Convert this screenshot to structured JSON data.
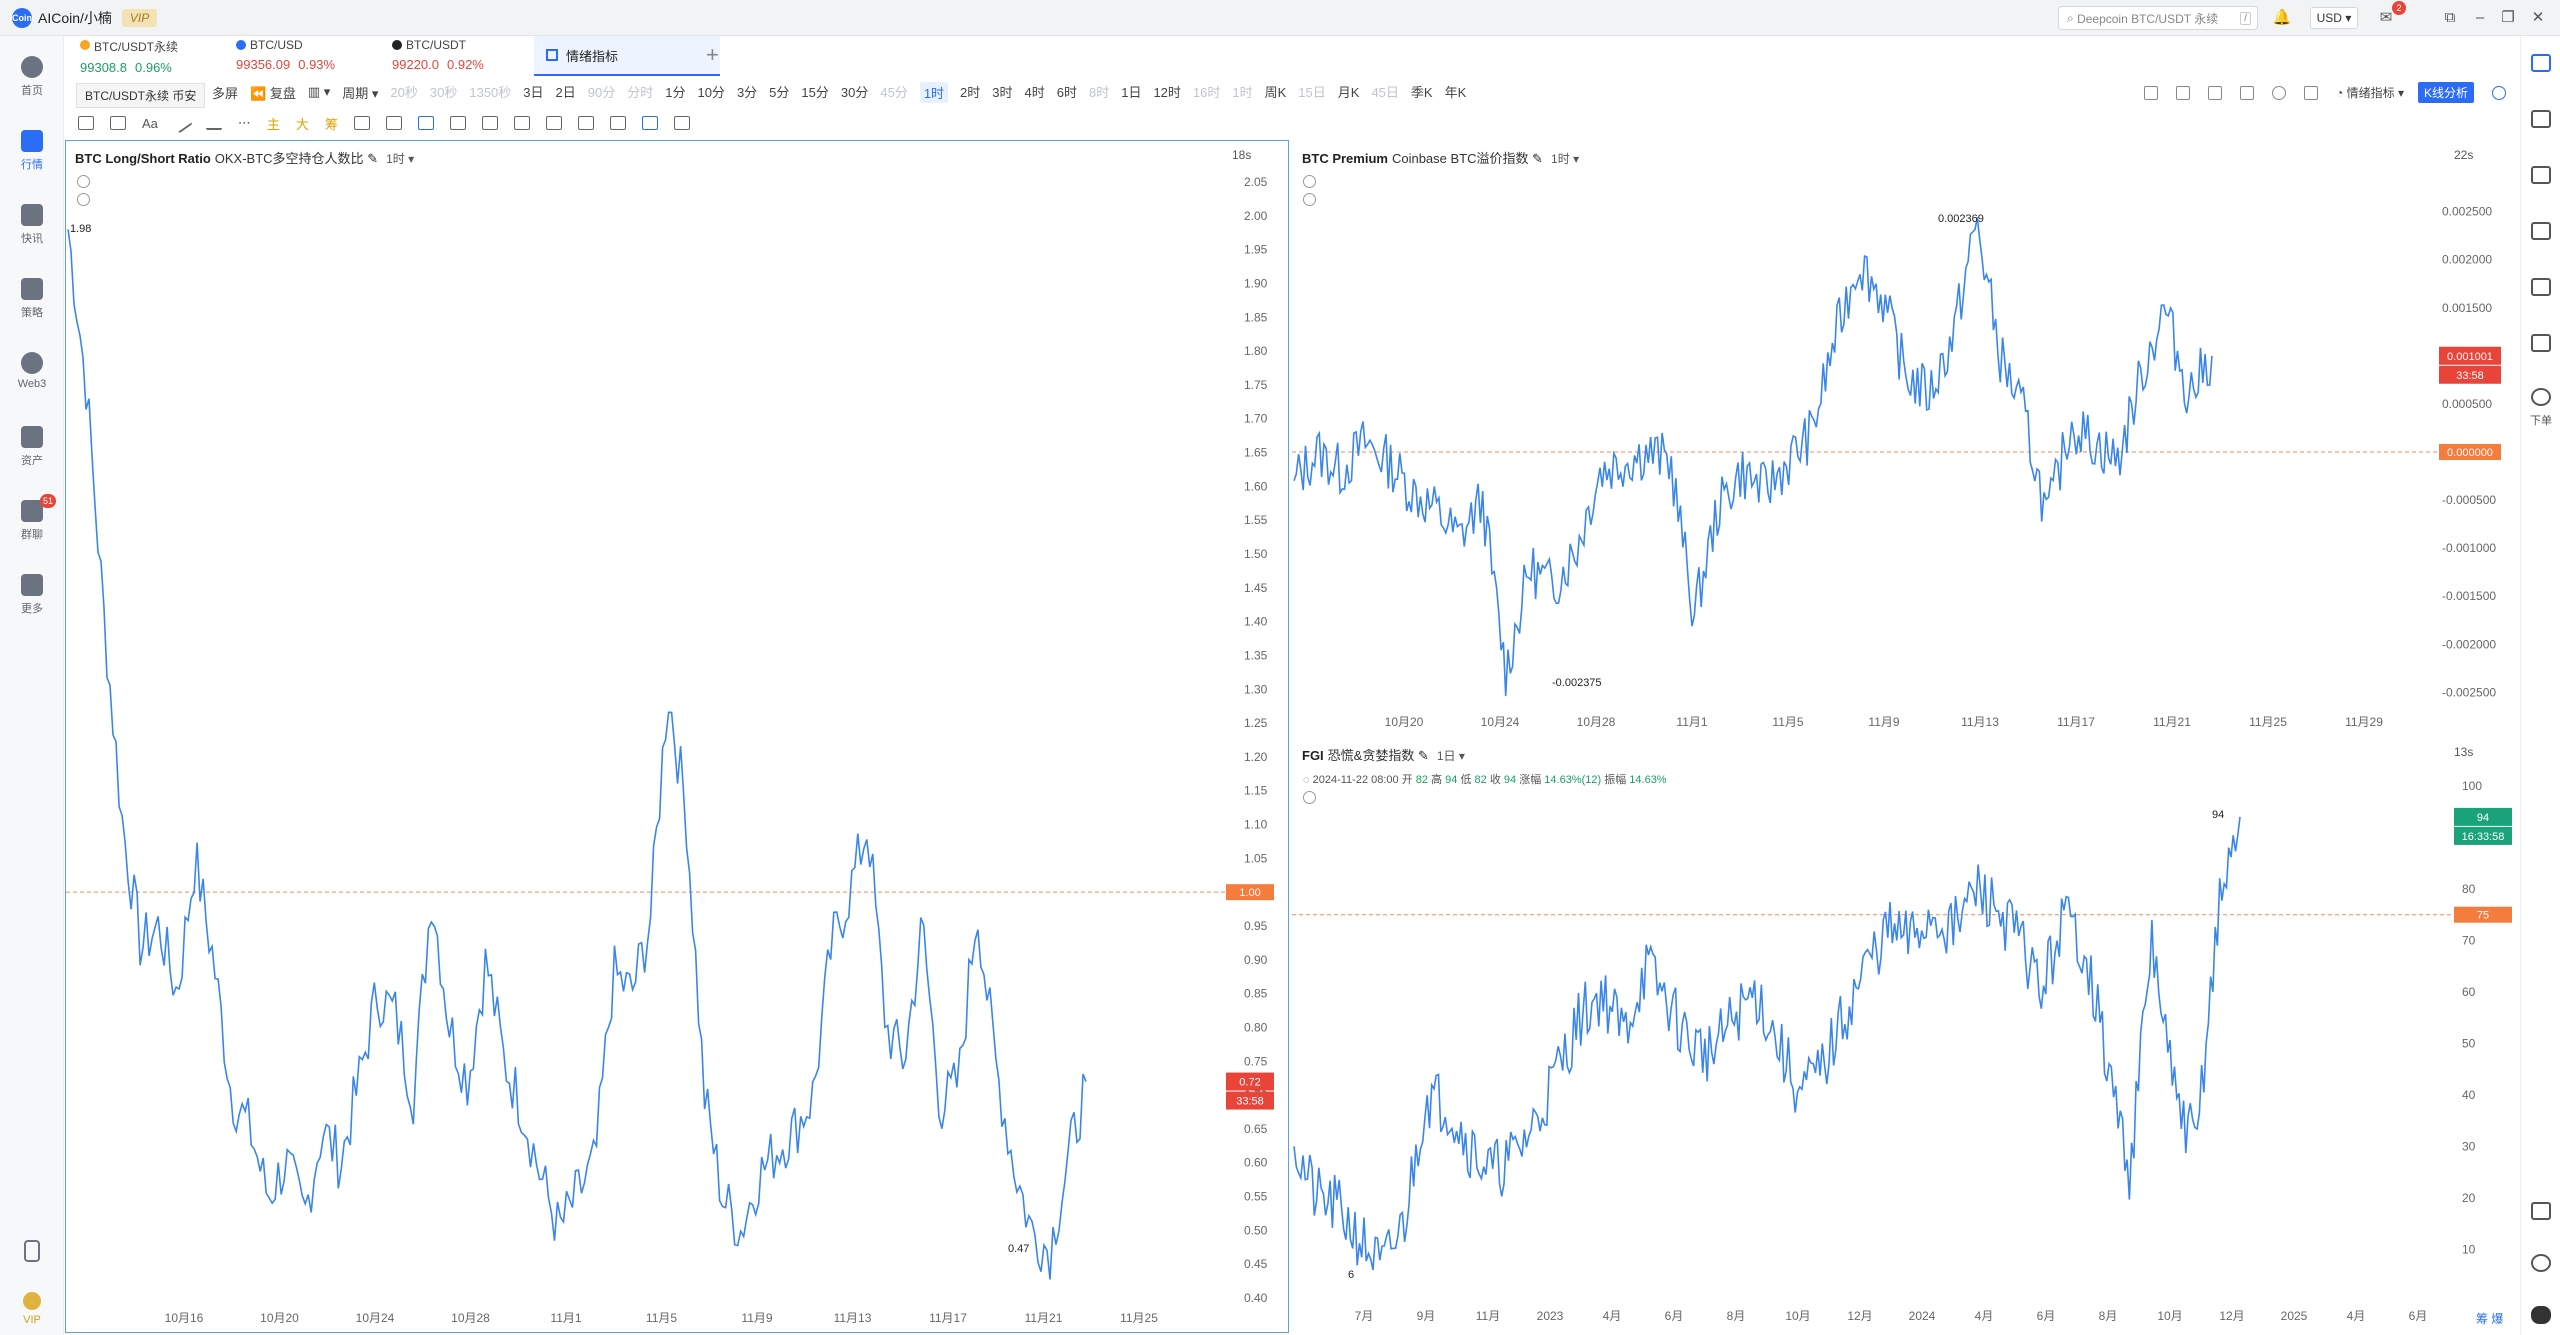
{
  "titlebar": {
    "logo_text": "Coin",
    "app_title": "AICoin/小楠",
    "vip": "VIP",
    "search_placeholder": "Deepcoin BTC/USDT 永续",
    "search_kbd": "/",
    "currency": "USD",
    "notifications": "2"
  },
  "sidebar": [
    {
      "label": "首页",
      "icon": "globe-icon"
    },
    {
      "label": "行情",
      "icon": "chart-icon",
      "active": true
    },
    {
      "label": "快讯",
      "icon": "news-icon"
    },
    {
      "label": "策略",
      "icon": "robot-icon"
    },
    {
      "label": "Web3",
      "icon": "web3-icon"
    },
    {
      "label": "资产",
      "icon": "wallet-icon"
    },
    {
      "label": "群聊",
      "icon": "chat-icon",
      "badge": "51"
    },
    {
      "label": "更多",
      "icon": "grid-icon"
    },
    {
      "label": "",
      "icon": "phone-icon"
    },
    {
      "label": "VIP",
      "icon": "vip-icon"
    }
  ],
  "rightbar": {
    "order_label": "下单"
  },
  "tickers": [
    {
      "name": "BTC/USDT永续",
      "price": "99308.8",
      "change": "0.96%",
      "dir": "up",
      "dot": "#f5a623"
    },
    {
      "name": "BTC/USD",
      "price": "99356.09",
      "change": "0.93%",
      "dir": "down",
      "dot": "#2a6df4"
    },
    {
      "name": "BTC/USDT",
      "price": "99220.0",
      "change": "0.92%",
      "dir": "down",
      "dot": "#222222"
    }
  ],
  "active_tab": "情绪指标",
  "tooltip": "BTC/USDT永续 币安",
  "periodbar": {
    "left": [
      "多屏",
      "复盘",
      "周期"
    ],
    "periods": [
      {
        "t": "20秒",
        "dim": true
      },
      {
        "t": "30秒",
        "dim": true
      },
      {
        "t": "1350秒",
        "dim": true
      },
      {
        "t": "3日"
      },
      {
        "t": "2日"
      },
      {
        "t": "90分",
        "dim": true
      },
      {
        "t": "分时",
        "dim": true
      },
      {
        "t": "1分"
      },
      {
        "t": "10分"
      },
      {
        "t": "3分"
      },
      {
        "t": "5分"
      },
      {
        "t": "15分"
      },
      {
        "t": "30分"
      },
      {
        "t": "45分",
        "dim": true
      },
      {
        "t": "1时",
        "active": true
      },
      {
        "t": "2时"
      },
      {
        "t": "3时"
      },
      {
        "t": "4时"
      },
      {
        "t": "6时"
      },
      {
        "t": "8时",
        "dim": true
      },
      {
        "t": "1日"
      },
      {
        "t": "12时"
      },
      {
        "t": "16时",
        "dim": true
      },
      {
        "t": "1时",
        "dim": true
      },
      {
        "t": "周K"
      },
      {
        "t": "15日",
        "dim": true
      },
      {
        "t": "月K"
      },
      {
        "t": "45日",
        "dim": true
      },
      {
        "t": "季K"
      },
      {
        "t": "年K"
      }
    ],
    "indicator_label": "情绪指标",
    "kline_button": "K线分析"
  },
  "drawbar": {
    "labels": [
      "Aa",
      "主",
      "大",
      "筹"
    ]
  },
  "panels": {
    "ls": {
      "title": "BTC Long/Short Ratio",
      "subtitle": "OKX-BTC多空持仓人数比",
      "timeframe": "1时",
      "timer": "18s",
      "price_tag": "0.72",
      "countdown": "33:58",
      "ref_tag": "1.00",
      "max_label": "1.98",
      "min_label": "0.47"
    },
    "premium": {
      "title": "BTC Premium",
      "subtitle": "Coinbase BTC溢价指数",
      "timeframe": "1时",
      "timer": "22s",
      "price_tag": "0.001001",
      "countdown": "33:58",
      "ref_tag": "0.000000",
      "max_label": "0.002369",
      "min_label": "-0.002375"
    },
    "fgi": {
      "title": "FGI",
      "subtitle": "恐慌&贪婪指数",
      "timeframe": "1日",
      "timer": "13s",
      "ohlc_date": "2024-11-22 08:00",
      "ohlc_open": "82",
      "ohlc_high": "94",
      "ohlc_low": "82",
      "ohlc_close": "94",
      "ohlc_change": "14.63%(12)",
      "ohlc_amp": "14.63%",
      "l_open": "开",
      "l_high": "高",
      "l_low": "低",
      "l_close": "收",
      "l_change": "涨幅",
      "l_amp": "振幅",
      "price_tag": "94",
      "countdown": "16:33:58",
      "ref_tag": "75",
      "max_label": "94",
      "min_label": "6",
      "corner": "筹  爆"
    }
  },
  "chart_data": [
    {
      "type": "line",
      "title": "BTC Long/Short Ratio",
      "ylim": [
        0.4,
        2.05
      ],
      "yticks": [
        "2.05",
        "2.00",
        "1.95",
        "1.90",
        "1.85",
        "1.80",
        "1.75",
        "1.70",
        "1.65",
        "1.60",
        "1.55",
        "1.50",
        "1.45",
        "1.40",
        "1.35",
        "1.30",
        "1.25",
        "1.20",
        "1.15",
        "1.10",
        "1.05",
        "1.00",
        "0.95",
        "0.90",
        "0.85",
        "0.80",
        "0.75",
        "0.70",
        "0.65",
        "0.60",
        "0.55",
        "0.50",
        "0.45",
        "0.40"
      ],
      "xticks": [
        "10月16",
        "10月20",
        "10月24",
        "10月28",
        "11月1",
        "11月5",
        "11月9",
        "11月13",
        "11月17",
        "11月21",
        "11月25"
      ],
      "series": [
        {
          "values": [
            1.98,
            1.75,
            1.4,
            1.1,
            0.92,
            0.95,
            0.85,
            1.05,
            0.9,
            0.7,
            0.65,
            0.55,
            0.6,
            0.52,
            0.65,
            0.6,
            0.72,
            0.85,
            0.82,
            0.7,
            1.0,
            0.8,
            0.72,
            0.9,
            0.75,
            0.68,
            0.58,
            0.5,
            0.55,
            0.6,
            0.88,
            0.85,
            0.95,
            1.3,
            1.12,
            0.7,
            0.55,
            0.5,
            0.58,
            0.62,
            0.65,
            0.7,
            0.92,
            1.0,
            1.1,
            0.8,
            0.75,
            0.95,
            0.68,
            0.72,
            0.98,
            0.75,
            0.6,
            0.5,
            0.47,
            0.6,
            0.72
          ]
        }
      ]
    },
    {
      "type": "line",
      "title": "BTC Premium",
      "ylim": [
        -0.0026,
        0.0026
      ],
      "yticks": [
        "0.002500",
        "0.002000",
        "0.001500",
        "0.001000",
        "0.000500",
        "0.000000",
        "-0.000500",
        "-0.001000",
        "-0.001500",
        "-0.002000",
        "-0.002500"
      ],
      "xticks": [
        "10月20",
        "10月24",
        "10月28",
        "11月1",
        "11月5",
        "11月9",
        "11月13",
        "11月17",
        "11月21",
        "11月25",
        "11月29"
      ],
      "series": [
        {
          "values": [
            -0.0003,
            0.0,
            -0.0002,
            0.0001,
            -0.0001,
            -0.0004,
            -0.0006,
            -0.0009,
            -0.0005,
            -0.0023,
            -0.0012,
            -0.0014,
            -0.001,
            -0.0002,
            -0.0001,
            0.0,
            -0.0001,
            -0.0017,
            -0.0006,
            -0.0002,
            -0.0004,
            -0.0001,
            0.0002,
            0.0012,
            0.002,
            0.0016,
            0.0008,
            0.0006,
            0.0012,
            0.0024,
            0.001,
            0.0004,
            -0.0007,
            0.0003,
            0.0001,
            -0.0001,
            0.0008,
            0.0015,
            0.0006,
            0.001
          ]
        }
      ]
    },
    {
      "type": "line",
      "title": "FGI",
      "ylim": [
        6,
        100
      ],
      "yticks": [
        "100",
        "90",
        "80",
        "70",
        "60",
        "50",
        "40",
        "30",
        "20",
        "10"
      ],
      "xticks": [
        "7月",
        "9月",
        "11月",
        "2023",
        "4月",
        "6月",
        "8月",
        "10月",
        "12月",
        "2024",
        "4月",
        "6月",
        "8月",
        "10月",
        "12月",
        "2025",
        "4月",
        "6月"
      ],
      "series": [
        {
          "values": [
            30,
            20,
            18,
            12,
            6,
            15,
            40,
            38,
            30,
            25,
            28,
            35,
            45,
            55,
            60,
            52,
            65,
            58,
            50,
            48,
            55,
            60,
            50,
            40,
            45,
            55,
            65,
            72,
            70,
            75,
            72,
            80,
            76,
            70,
            60,
            75,
            68,
            45,
            25,
            70,
            40,
            30,
            75,
            94
          ]
        }
      ]
    }
  ]
}
